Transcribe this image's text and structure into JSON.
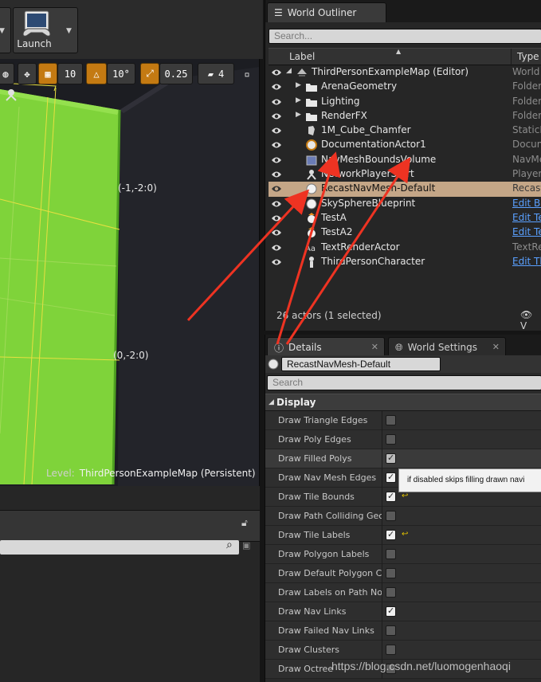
{
  "toolbar": {
    "launch_label": "Launch"
  },
  "viewport": {
    "snap_grid_value": "10",
    "snap_rotation_value": "10°",
    "snap_scale_value": "0.25",
    "camera_speed_value": "4",
    "coord_top": "(-1,-2:0)",
    "coord_mid": "(0,-2:0)",
    "level_prefix": "Level:",
    "level_name": "ThirdPersonExampleMap (Persistent)",
    "colors": {
      "nav_mesh_green": "#7fd33a",
      "tile_bound_yellow": "#e8e040"
    }
  },
  "outliner": {
    "tab_label": "World Outliner",
    "search_placeholder": "Search...",
    "col_label": "Label",
    "col_type": "Type",
    "rows": [
      {
        "label": "ThirdPersonExampleMap (Editor)",
        "type": "World",
        "indent": 0,
        "icon": "world-icon",
        "expander": "open"
      },
      {
        "label": "ArenaGeometry",
        "type": "Folder",
        "indent": 1,
        "icon": "folder-icon",
        "expander": "closed"
      },
      {
        "label": "Lighting",
        "type": "Folder",
        "indent": 1,
        "icon": "folder-icon",
        "expander": "closed"
      },
      {
        "label": "RenderFX",
        "type": "Folder",
        "indent": 1,
        "icon": "folder-icon",
        "expander": "closed"
      },
      {
        "label": "1M_Cube_Chamfer",
        "type": "StaticM",
        "indent": 1,
        "icon": "static-mesh-icon"
      },
      {
        "label": "DocumentationActor1",
        "type": "Docum",
        "indent": 1,
        "icon": "documentation-icon"
      },
      {
        "label": "NavMeshBoundsVolume",
        "type": "NavMe",
        "indent": 1,
        "icon": "volume-icon"
      },
      {
        "label": "NetworkPlayerStart",
        "type": "PlayerS",
        "indent": 1,
        "icon": "player-start-icon"
      },
      {
        "label": "RecastNavMesh-Default",
        "type": "Recast",
        "indent": 1,
        "icon": "sphere-icon",
        "selected": true
      },
      {
        "label": "SkySphereBlueprint",
        "type": "Edit BP",
        "indent": 1,
        "icon": "sphere-icon",
        "link": true
      },
      {
        "label": "TestA",
        "type": "Edit Te",
        "indent": 1,
        "icon": "actor-icon",
        "link": true
      },
      {
        "label": "TestA2",
        "type": "Edit Te",
        "indent": 1,
        "icon": "actor-icon",
        "link": true
      },
      {
        "label": "TextRenderActor",
        "type": "TextRe",
        "indent": 1,
        "icon": "text-render-icon"
      },
      {
        "label": "ThirdPersonCharacter",
        "type": "Edit Th",
        "indent": 1,
        "icon": "character-icon",
        "link": true
      }
    ],
    "footer_count": "26 actors (1 selected)",
    "footer_view": "V"
  },
  "details": {
    "tab_details": "Details",
    "tab_world_settings": "World Settings",
    "actor_name": "RecastNavMesh-Default",
    "search_placeholder": "Search",
    "section": "Display",
    "properties": [
      {
        "name": "Draw Triangle Edges",
        "checked": false
      },
      {
        "name": "Draw Poly Edges",
        "checked": false
      },
      {
        "name": "Draw Filled Polys",
        "checked": true,
        "dim": true,
        "highlight": true
      },
      {
        "name": "Draw Nav Mesh Edges",
        "checked": true
      },
      {
        "name": "Draw Tile Bounds",
        "checked": true,
        "reset": true
      },
      {
        "name": "Draw Path Colliding Geom",
        "checked": false
      },
      {
        "name": "Draw Tile Labels",
        "checked": true,
        "reset": true
      },
      {
        "name": "Draw Polygon Labels",
        "checked": false
      },
      {
        "name": "Draw Default Polygon Cos",
        "checked": false
      },
      {
        "name": "Draw Labels on Path Node",
        "checked": false
      },
      {
        "name": "Draw Nav Links",
        "checked": true
      },
      {
        "name": "Draw Failed Nav Links",
        "checked": false
      },
      {
        "name": "Draw Clusters",
        "checked": false
      },
      {
        "name": "Draw Octree",
        "checked": false
      }
    ],
    "tooltip": "if disabled skips filling drawn navi"
  },
  "watermark": "https://blog.csdn.net/luomogenhaoqi"
}
